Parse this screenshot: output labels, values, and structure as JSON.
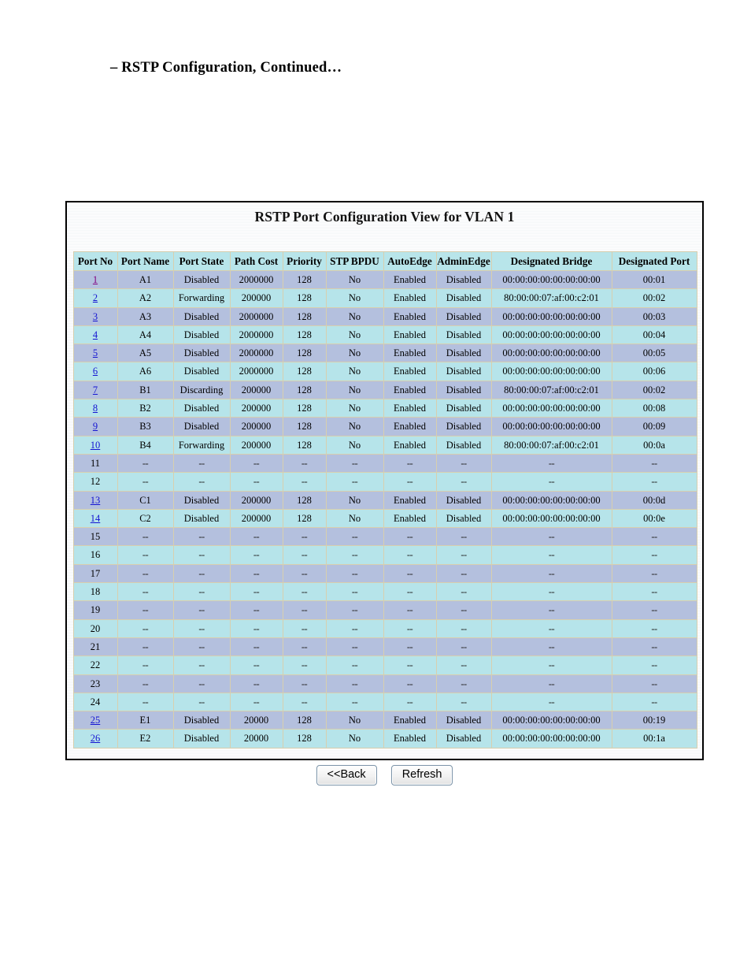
{
  "page": {
    "heading": "– RSTP Configuration, Continued…"
  },
  "panel": {
    "title": "RSTP Port Configuration View for VLAN 1"
  },
  "table": {
    "columns": [
      "Port No",
      "Port Name",
      "Port State",
      "Path Cost",
      "Priority",
      "STP BPDU",
      "AutoEdge",
      "AdminEdge",
      "Designated Bridge",
      "Designated Port"
    ],
    "rows": [
      {
        "port_no": "1",
        "link": true,
        "visited": true,
        "port_name": "A1",
        "port_state": "Disabled",
        "path_cost": "2000000",
        "priority": "128",
        "stp_bpdu": "No",
        "auto_edge": "Enabled",
        "admin_edge": "Disabled",
        "designated_bridge": "00:00:00:00:00:00:00:00",
        "designated_port": "00:01"
      },
      {
        "port_no": "2",
        "link": true,
        "visited": false,
        "port_name": "A2",
        "port_state": "Forwarding",
        "path_cost": "200000",
        "priority": "128",
        "stp_bpdu": "No",
        "auto_edge": "Enabled",
        "admin_edge": "Disabled",
        "designated_bridge": "80:00:00:07:af:00:c2:01",
        "designated_port": "00:02"
      },
      {
        "port_no": "3",
        "link": true,
        "visited": false,
        "port_name": "A3",
        "port_state": "Disabled",
        "path_cost": "2000000",
        "priority": "128",
        "stp_bpdu": "No",
        "auto_edge": "Enabled",
        "admin_edge": "Disabled",
        "designated_bridge": "00:00:00:00:00:00:00:00",
        "designated_port": "00:03"
      },
      {
        "port_no": "4",
        "link": true,
        "visited": false,
        "port_name": "A4",
        "port_state": "Disabled",
        "path_cost": "2000000",
        "priority": "128",
        "stp_bpdu": "No",
        "auto_edge": "Enabled",
        "admin_edge": "Disabled",
        "designated_bridge": "00:00:00:00:00:00:00:00",
        "designated_port": "00:04"
      },
      {
        "port_no": "5",
        "link": true,
        "visited": false,
        "port_name": "A5",
        "port_state": "Disabled",
        "path_cost": "2000000",
        "priority": "128",
        "stp_bpdu": "No",
        "auto_edge": "Enabled",
        "admin_edge": "Disabled",
        "designated_bridge": "00:00:00:00:00:00:00:00",
        "designated_port": "00:05"
      },
      {
        "port_no": "6",
        "link": true,
        "visited": false,
        "port_name": "A6",
        "port_state": "Disabled",
        "path_cost": "2000000",
        "priority": "128",
        "stp_bpdu": "No",
        "auto_edge": "Enabled",
        "admin_edge": "Disabled",
        "designated_bridge": "00:00:00:00:00:00:00:00",
        "designated_port": "00:06"
      },
      {
        "port_no": "7",
        "link": true,
        "visited": false,
        "port_name": "B1",
        "port_state": "Discarding",
        "path_cost": "200000",
        "priority": "128",
        "stp_bpdu": "No",
        "auto_edge": "Enabled",
        "admin_edge": "Disabled",
        "designated_bridge": "80:00:00:07:af:00:c2:01",
        "designated_port": "00:02"
      },
      {
        "port_no": "8",
        "link": true,
        "visited": false,
        "port_name": "B2",
        "port_state": "Disabled",
        "path_cost": "200000",
        "priority": "128",
        "stp_bpdu": "No",
        "auto_edge": "Enabled",
        "admin_edge": "Disabled",
        "designated_bridge": "00:00:00:00:00:00:00:00",
        "designated_port": "00:08"
      },
      {
        "port_no": "9",
        "link": true,
        "visited": false,
        "port_name": "B3",
        "port_state": "Disabled",
        "path_cost": "200000",
        "priority": "128",
        "stp_bpdu": "No",
        "auto_edge": "Enabled",
        "admin_edge": "Disabled",
        "designated_bridge": "00:00:00:00:00:00:00:00",
        "designated_port": "00:09"
      },
      {
        "port_no": "10",
        "link": true,
        "visited": false,
        "port_name": "B4",
        "port_state": "Forwarding",
        "path_cost": "200000",
        "priority": "128",
        "stp_bpdu": "No",
        "auto_edge": "Enabled",
        "admin_edge": "Disabled",
        "designated_bridge": "80:00:00:07:af:00:c2:01",
        "designated_port": "00:0a"
      },
      {
        "port_no": "11",
        "link": false,
        "visited": false,
        "port_name": "--",
        "port_state": "--",
        "path_cost": "--",
        "priority": "--",
        "stp_bpdu": "--",
        "auto_edge": "--",
        "admin_edge": "--",
        "designated_bridge": "--",
        "designated_port": "--"
      },
      {
        "port_no": "12",
        "link": false,
        "visited": false,
        "port_name": "--",
        "port_state": "--",
        "path_cost": "--",
        "priority": "--",
        "stp_bpdu": "--",
        "auto_edge": "--",
        "admin_edge": "--",
        "designated_bridge": "--",
        "designated_port": "--"
      },
      {
        "port_no": "13",
        "link": true,
        "visited": false,
        "port_name": "C1",
        "port_state": "Disabled",
        "path_cost": "200000",
        "priority": "128",
        "stp_bpdu": "No",
        "auto_edge": "Enabled",
        "admin_edge": "Disabled",
        "designated_bridge": "00:00:00:00:00:00:00:00",
        "designated_port": "00:0d"
      },
      {
        "port_no": "14",
        "link": true,
        "visited": false,
        "port_name": "C2",
        "port_state": "Disabled",
        "path_cost": "200000",
        "priority": "128",
        "stp_bpdu": "No",
        "auto_edge": "Enabled",
        "admin_edge": "Disabled",
        "designated_bridge": "00:00:00:00:00:00:00:00",
        "designated_port": "00:0e"
      },
      {
        "port_no": "15",
        "link": false,
        "visited": false,
        "port_name": "--",
        "port_state": "--",
        "path_cost": "--",
        "priority": "--",
        "stp_bpdu": "--",
        "auto_edge": "--",
        "admin_edge": "--",
        "designated_bridge": "--",
        "designated_port": "--"
      },
      {
        "port_no": "16",
        "link": false,
        "visited": false,
        "port_name": "--",
        "port_state": "--",
        "path_cost": "--",
        "priority": "--",
        "stp_bpdu": "--",
        "auto_edge": "--",
        "admin_edge": "--",
        "designated_bridge": "--",
        "designated_port": "--"
      },
      {
        "port_no": "17",
        "link": false,
        "visited": false,
        "port_name": "--",
        "port_state": "--",
        "path_cost": "--",
        "priority": "--",
        "stp_bpdu": "--",
        "auto_edge": "--",
        "admin_edge": "--",
        "designated_bridge": "--",
        "designated_port": "--"
      },
      {
        "port_no": "18",
        "link": false,
        "visited": false,
        "port_name": "--",
        "port_state": "--",
        "path_cost": "--",
        "priority": "--",
        "stp_bpdu": "--",
        "auto_edge": "--",
        "admin_edge": "--",
        "designated_bridge": "--",
        "designated_port": "--"
      },
      {
        "port_no": "19",
        "link": false,
        "visited": false,
        "port_name": "--",
        "port_state": "--",
        "path_cost": "--",
        "priority": "--",
        "stp_bpdu": "--",
        "auto_edge": "--",
        "admin_edge": "--",
        "designated_bridge": "--",
        "designated_port": "--"
      },
      {
        "port_no": "20",
        "link": false,
        "visited": false,
        "port_name": "--",
        "port_state": "--",
        "path_cost": "--",
        "priority": "--",
        "stp_bpdu": "--",
        "auto_edge": "--",
        "admin_edge": "--",
        "designated_bridge": "--",
        "designated_port": "--"
      },
      {
        "port_no": "21",
        "link": false,
        "visited": false,
        "port_name": "--",
        "port_state": "--",
        "path_cost": "--",
        "priority": "--",
        "stp_bpdu": "--",
        "auto_edge": "--",
        "admin_edge": "--",
        "designated_bridge": "--",
        "designated_port": "--"
      },
      {
        "port_no": "22",
        "link": false,
        "visited": false,
        "port_name": "--",
        "port_state": "--",
        "path_cost": "--",
        "priority": "--",
        "stp_bpdu": "--",
        "auto_edge": "--",
        "admin_edge": "--",
        "designated_bridge": "--",
        "designated_port": "--"
      },
      {
        "port_no": "23",
        "link": false,
        "visited": false,
        "port_name": "--",
        "port_state": "--",
        "path_cost": "--",
        "priority": "--",
        "stp_bpdu": "--",
        "auto_edge": "--",
        "admin_edge": "--",
        "designated_bridge": "--",
        "designated_port": "--"
      },
      {
        "port_no": "24",
        "link": false,
        "visited": false,
        "port_name": "--",
        "port_state": "--",
        "path_cost": "--",
        "priority": "--",
        "stp_bpdu": "--",
        "auto_edge": "--",
        "admin_edge": "--",
        "designated_bridge": "--",
        "designated_port": "--"
      },
      {
        "port_no": "25",
        "link": true,
        "visited": false,
        "port_name": "E1",
        "port_state": "Disabled",
        "path_cost": "20000",
        "priority": "128",
        "stp_bpdu": "No",
        "auto_edge": "Enabled",
        "admin_edge": "Disabled",
        "designated_bridge": "00:00:00:00:00:00:00:00",
        "designated_port": "00:19"
      },
      {
        "port_no": "26",
        "link": true,
        "visited": false,
        "port_name": "E2",
        "port_state": "Disabled",
        "path_cost": "20000",
        "priority": "128",
        "stp_bpdu": "No",
        "auto_edge": "Enabled",
        "admin_edge": "Disabled",
        "designated_bridge": "00:00:00:00:00:00:00:00",
        "designated_port": "00:1a"
      }
    ]
  },
  "buttons": {
    "back": "<<Back",
    "refresh": "Refresh"
  },
  "colors": {
    "header_bg": "#b8e5ea",
    "row_odd_bg": "#b4c0de",
    "row_even_bg": "#b6e4ea",
    "cell_border": "#d8cfae",
    "link": "#1414d2",
    "link_visited": "#800080"
  }
}
